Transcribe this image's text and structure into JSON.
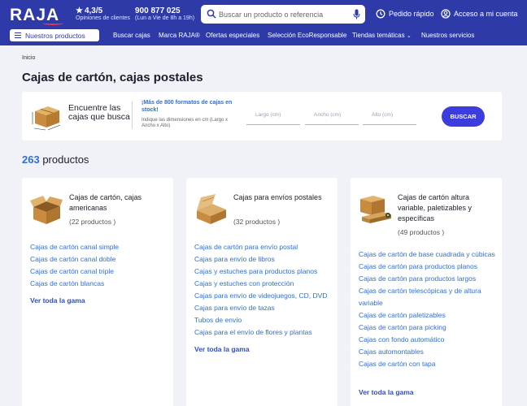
{
  "header": {
    "logo": "RAJA",
    "rating": {
      "value": "4,3/5",
      "label": "Opiniones de clientes"
    },
    "phone": {
      "number": "900 877 025",
      "hours": "(Lun a Vie de 8h a 19h)"
    },
    "search": {
      "placeholder": "Buscar un producto o referencia"
    },
    "quick_order": "Pedido rápido",
    "account": "Acceso a mi cuenta",
    "brand_color": "#2e3aa8"
  },
  "nav": {
    "products_button": "Nuestros productos",
    "links": [
      "Buscar cajas",
      "Marca RAJA®",
      "Ofertas especiales",
      "Selección EcoResponsable",
      "Tiendas temáticas",
      "Nuestros servicios"
    ]
  },
  "breadcrumb": "Inicio",
  "page_title": "Cajas de cartón, cajas postales",
  "finder": {
    "title": "Encuentre las cajas que busca",
    "promo": "¡Más de 800 formatos de cajas en stock!",
    "hint": "Indique las dimensiones en cm (Largo x Ancho x Alto)",
    "fields": [
      {
        "placeholder": "Largo (cm)"
      },
      {
        "placeholder": "Ancho (cm)"
      },
      {
        "placeholder": "Alto (cm)"
      }
    ],
    "button": "BUSCAR"
  },
  "results": {
    "count": "263",
    "label": "productos"
  },
  "cards": [
    {
      "title": "Cajas de cartón, cajas americanas",
      "count": "(22 productos )",
      "links": [
        "Cajas de cartón canal simple",
        "Cajas de cartón canal doble",
        "Cajas de cartón canal triple",
        "Cajas de cartón blancas"
      ],
      "see_all": "Ver toda la gama",
      "icon": "open-cardboard-box-icon"
    },
    {
      "title": "Cajas para envíos postales",
      "count": "(32 productos )",
      "links": [
        "Cajas de cartón para envío postal",
        "Cajas para envío de libros",
        "Cajas y estuches para productos planos",
        "Cajas y estuches con protección",
        "Cajas para envío de videojuegos, CD, DVD",
        "Cajas para envío de tazas",
        "Tubos de envío",
        "Cajas para el envío de flores y plantas"
      ],
      "see_all": "Ver toda la gama",
      "icon": "postal-box-icon"
    },
    {
      "title": "Cajas de cartón altura variable, paletizables y específicas",
      "count": "(49 productos )",
      "links": [
        "Cajas de cartón de base cuadrada y cúbicas",
        "Cajas de cartón para productos planos",
        "Cajas de cartón para productos largos",
        "Cajas de cartón telescópicas y de altura variable",
        "Cajas de cartón paletizables",
        "Cajas de cartón para picking",
        "Cajas con fondo automático",
        "Cajas automontables",
        "Cajas de cartón con tapa"
      ],
      "see_all": "Ver toda la gama",
      "icon": "long-boxes-icon"
    }
  ]
}
